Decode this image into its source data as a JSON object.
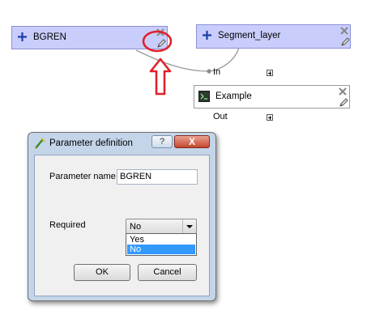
{
  "nodes": {
    "bgren": {
      "label": "BGREN"
    },
    "segment": {
      "label": "Segment_layer"
    },
    "example": {
      "label": "Example"
    }
  },
  "ports": {
    "in_label": "In",
    "out_label": "Out"
  },
  "icons": {
    "plus": "plus-icon",
    "remove": "remove-x-icon",
    "edit": "pencil-edit-icon",
    "annotation_arrow": "red-up-arrow-icon",
    "annotation_circle": "red-circle-highlight"
  },
  "colors": {
    "node_fill": "#c9cdfb",
    "highlight_red": "#e0202a",
    "selection_blue": "#3399ff",
    "close_red": "#c5462c"
  },
  "dialog": {
    "title": "Parameter definition",
    "help_label": "?",
    "close_label": "X",
    "param_name_label": "Parameter name",
    "param_name_value": "BGREN",
    "required_label": "Required",
    "required_value": "No",
    "options": [
      "Yes",
      "No"
    ],
    "ok_label": "OK",
    "cancel_label": "Cancel"
  }
}
